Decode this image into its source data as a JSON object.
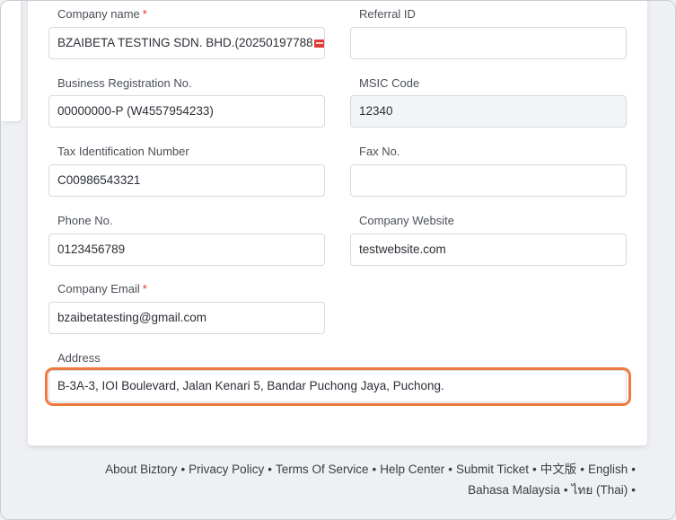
{
  "form": {
    "company_name": {
      "label": "Company name",
      "required_mark": "*",
      "value": "BZAIBETA TESTING SDN. BHD.(20250197788"
    },
    "referral_id": {
      "label": "Referral ID",
      "value": ""
    },
    "business_reg": {
      "label": "Business Registration No.",
      "value": "00000000-P (W4557954233)"
    },
    "msic_code": {
      "label": "MSIC Code",
      "value": "12340"
    },
    "tax_id": {
      "label": "Tax Identification Number",
      "value": "C00986543321"
    },
    "fax": {
      "label": "Fax No.",
      "value": ""
    },
    "phone": {
      "label": "Phone No.",
      "value": "0123456789"
    },
    "website": {
      "label": "Company Website",
      "value": "testwebsite.com"
    },
    "email": {
      "label": "Company Email",
      "required_mark": "*",
      "value": "bzaibetatesting@gmail.com"
    },
    "address": {
      "label": "Address",
      "value": "B-3A-3, IOI Boulevard, Jalan Kenari 5, Bandar Puchong Jaya, Puchong."
    }
  },
  "footer": {
    "links": [
      "About Biztory",
      "Privacy Policy",
      "Terms Of Service",
      "Help Center",
      "Submit Ticket",
      "中文版",
      "English",
      "Bahasa Malaysia",
      "ไทย (Thai)"
    ],
    "separator": "•"
  },
  "colors": {
    "highlight": "#f07a3d",
    "required": "#e03131"
  }
}
